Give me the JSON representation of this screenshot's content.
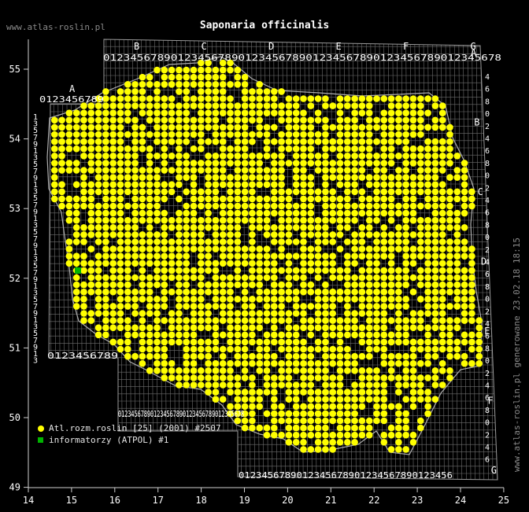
{
  "site_label": "www.atlas-roslin.pl",
  "title": "Saponaria officinalis",
  "generated_label": "www.atlas-roslin.pl generowane 23.02.18 18:15",
  "axes": {
    "x_ticks": [
      "14",
      "15",
      "16",
      "17",
      "18",
      "19",
      "20",
      "21",
      "22",
      "23",
      "24",
      "25"
    ],
    "y_ticks": [
      "55",
      "54",
      "53",
      "52",
      "51",
      "50",
      "49"
    ]
  },
  "grid": {
    "top_letters": [
      "B",
      "C",
      "D",
      "E",
      "F",
      "G"
    ],
    "top_digits": "01234567890123456789012345678901234567890123456789012345678",
    "left_top_letter": "A",
    "left_top_digits": "0123456789",
    "bottom_left_digits": "0123456789",
    "bottom_mid_digits": "012345678901234567890123456789012345678",
    "bottom_low_digits": "0123456789012345678901234567890123456",
    "left_rows": [
      "1",
      "3",
      "5",
      "7",
      "9",
      "1",
      "3",
      "5",
      "7",
      "9",
      "1",
      "3",
      "5",
      "7",
      "9",
      "1",
      "3",
      "5",
      "7",
      "9",
      "1",
      "3",
      "5",
      "7",
      "9",
      "1",
      "3",
      "5",
      "7",
      "9",
      "1",
      "3",
      "5",
      "7",
      "9",
      "1",
      "3"
    ],
    "right_rows": [
      "4",
      "6",
      "8",
      "0",
      "2",
      "4",
      "6",
      "8",
      "0",
      "2",
      "4",
      "6",
      "8",
      "0",
      "2",
      "4",
      "6",
      "8",
      "0",
      "2",
      "4",
      "6",
      "8",
      "0",
      "2",
      "4",
      "6",
      "8",
      "0",
      "2",
      "4",
      "6"
    ],
    "right_letters": [
      "A",
      "B",
      "C",
      "D",
      "E",
      "F",
      "G"
    ]
  },
  "legend": [
    {
      "label": "Atl.rozm.roslin [25] (2001) #2507",
      "color": "#ffff00",
      "shape": "circle"
    },
    {
      "label": "informatorzy (ATPOL) #1",
      "color": "#00b300",
      "shape": "square"
    }
  ],
  "colors": {
    "background": "#000000",
    "grid": "#6e6e6e",
    "border": "#b0b0b0",
    "records": "#ffff00",
    "atpol": "#00b300"
  }
}
